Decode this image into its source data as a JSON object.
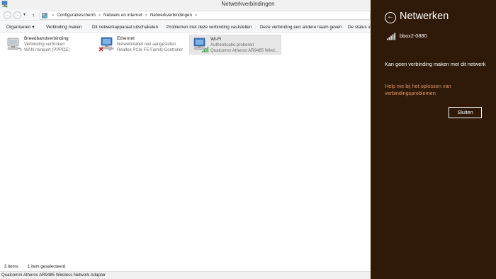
{
  "window": {
    "title": "Netwerkverbindingen"
  },
  "address": {
    "back_arrow": "←",
    "forward_arrow": "→",
    "recent_arrow": "▾",
    "up_arrow": "↑",
    "crumbs": [
      "Configuratiescherm",
      "Netwerk en internet",
      "Netwerkverbindingen"
    ],
    "separator": ">"
  },
  "toolbar": {
    "organize": "Organiseren ▾",
    "connect": "Verbinding maken",
    "disable": "Dit netwerkapparaat uitschakelen",
    "diagnose": "Problemen met deze verbinding vaststellen",
    "rename": "Deze verbinding een andere naam geven",
    "status": "De status van deze verbinding weergeven"
  },
  "connections": [
    {
      "name": "Breedbandverbinding",
      "status": "Verbinding verbroken",
      "device": "WAN-miniport (PPPOE)",
      "icon": "broadband-icon"
    },
    {
      "name": "Ethernet",
      "status": "Netwerkkabel niet aangesloten",
      "device": "Realtek PCIe FE Family Controller",
      "icon": "ethernet-icon"
    },
    {
      "name": "Wi-Fi",
      "status": "Authenticatie proberen",
      "device": "Qualcomm Atheros AR9485 Wirel...",
      "icon": "wifi-icon"
    }
  ],
  "status": {
    "items_count": "3 items",
    "selected": "1 item geselecteerd",
    "details": "Qualcomm Atheros AR9485 Wireless Network Adapter"
  },
  "charm": {
    "title": "Netwerken",
    "back_arrow": "←",
    "network": "bbox2-0880",
    "message": "Kan geen verbinding maken met dit netwerk",
    "help_link": "Help me bij het oplossen van verbindingsproblemen",
    "close": "Sluiten"
  },
  "colors": {
    "charm_background": "#2e1a07",
    "link": "#e3936a",
    "selection": "#e6e6e6"
  }
}
